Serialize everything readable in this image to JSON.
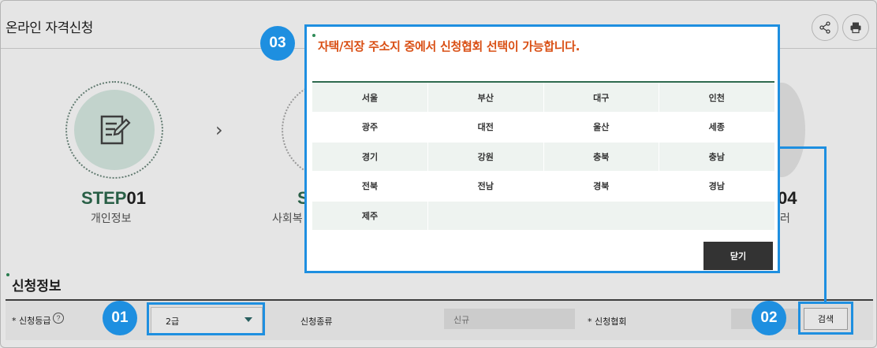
{
  "page": {
    "title": "온라인 자격신청"
  },
  "header_actions": {
    "share_icon": "share-icon",
    "print_icon": "print-icon"
  },
  "steps": [
    {
      "label_prefix": "STEP",
      "label_num": "01",
      "sub": "개인정보"
    },
    {
      "label_prefix": "S",
      "sub": "사회복"
    },
    {
      "label_num": "04",
      "sub": "러"
    }
  ],
  "section": {
    "title": "신청정보",
    "grade_label": "* 신청등급",
    "grade_value": "2급",
    "type_label": "신청종류",
    "type_value": "신규",
    "assoc_label": "* 신청협회",
    "search_label": "검색"
  },
  "badges": {
    "b01": "01",
    "b02": "02",
    "b03": "03"
  },
  "modal": {
    "title": "자택/직장 주소지 중에서 신청협회 선택이 가능합니다.",
    "regions": [
      [
        "서울",
        "부산",
        "대구",
        "인천"
      ],
      [
        "광주",
        "대전",
        "울산",
        "세종"
      ],
      [
        "경기",
        "강원",
        "충북",
        "충남"
      ],
      [
        "전북",
        "전남",
        "경북",
        "경남"
      ],
      [
        "제주"
      ]
    ],
    "close_label": "닫기"
  },
  "colors": {
    "accent": "#1e8fe0",
    "brand_green": "#2e6a4e",
    "title_orange": "#d94f14"
  }
}
